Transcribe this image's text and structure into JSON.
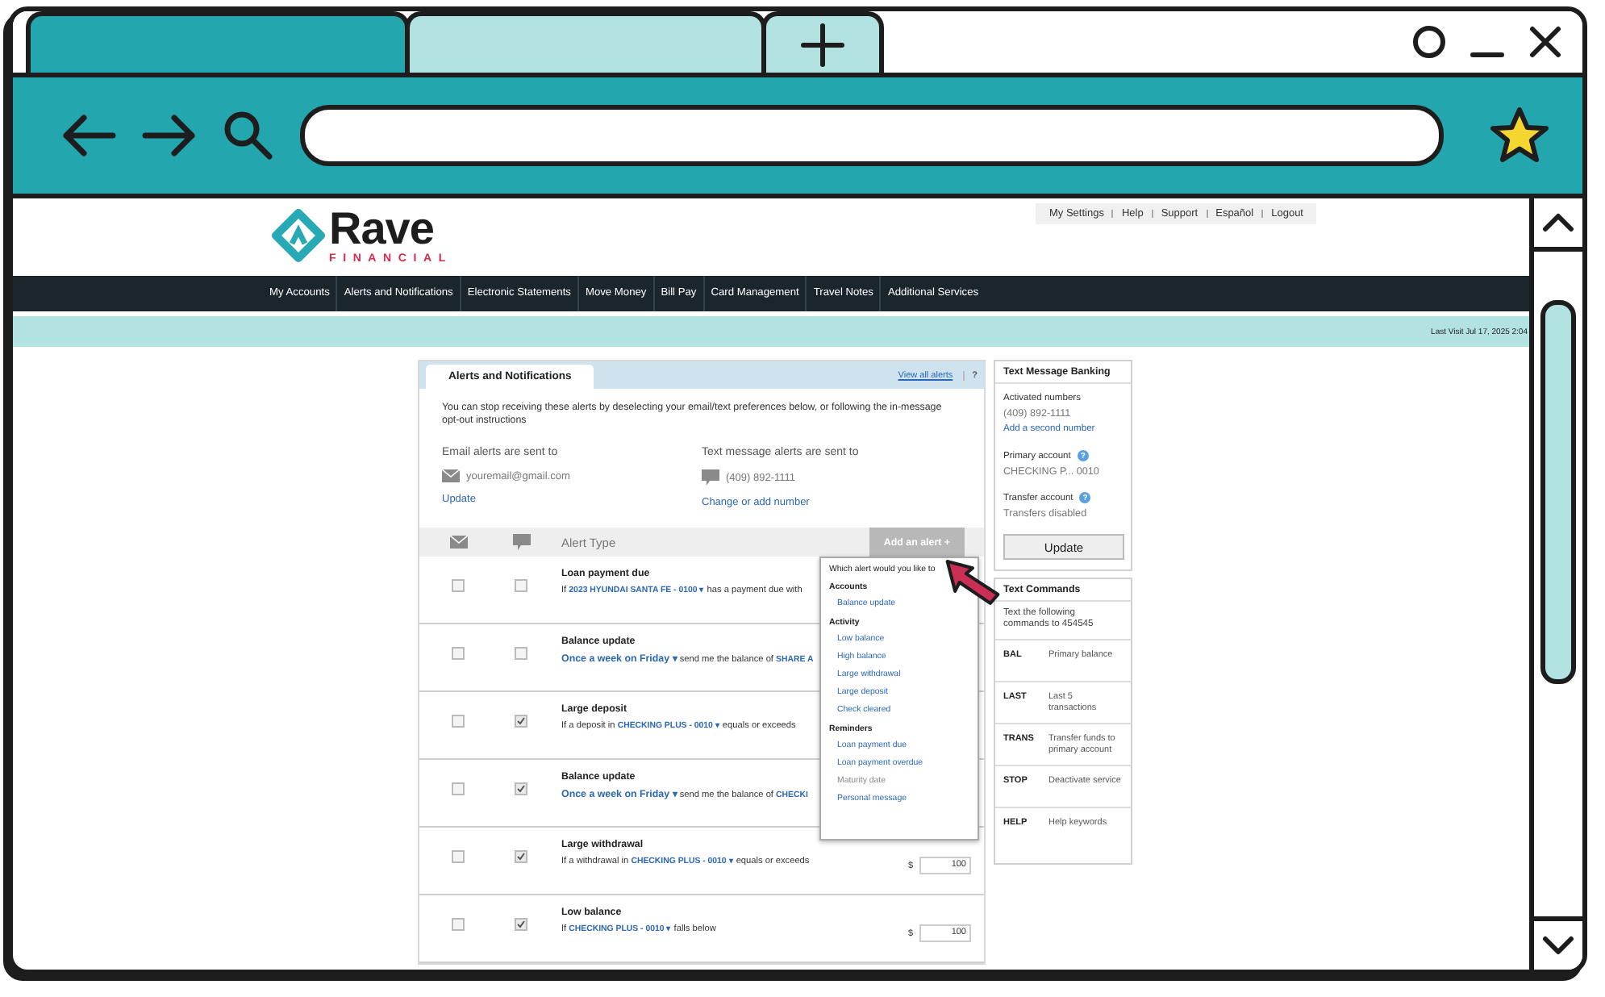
{
  "browser": {
    "tabs": [
      {
        "selected": true
      },
      {
        "selected": false
      }
    ]
  },
  "page": {
    "logo": {
      "name": "Rave",
      "tagline": "FINANCIAL"
    },
    "utility_links": [
      "My Settings",
      "Help",
      "Support",
      "Español",
      "Logout"
    ],
    "nav": [
      "My Accounts",
      "Alerts and Notifications",
      "Electronic Statements",
      "Move Money",
      "Bill Pay",
      "Card Management",
      "Travel Notes",
      "Additional Services"
    ],
    "last_visit": "Last Visit Jul 17, 2025 2:04",
    "alerts": {
      "tab": "Alerts and Notifications",
      "view_all": "View all alerts",
      "help": "?",
      "intro": "You can stop receiving these alerts by deselecting your email/text preferences below, or following the in-message opt-out instructions",
      "email_label": "Email alerts are sent to",
      "email": "youremail@gmail.com",
      "email_link": "Update",
      "text_label": "Text message alerts are sent to",
      "phone": "(409) 892-1111",
      "text_link": "Change or add number",
      "column_alert_type": "Alert Type",
      "add_button": "Add an alert +",
      "rows": [
        {
          "title": "Loan payment due",
          "email_checked": false,
          "text_checked": false,
          "description": [
            {
              "kind": "text",
              "text": "If "
            },
            {
              "kind": "account",
              "text": "2023 HYUNDAI SANTA FE - 0100 ▾"
            },
            {
              "kind": "text",
              "text": " has a payment due with"
            }
          ]
        },
        {
          "title": "Balance update",
          "email_checked": false,
          "text_checked": false,
          "description": [
            {
              "kind": "link",
              "text": "Once a week on Friday ▾"
            },
            {
              "kind": "text",
              "text": " send me the balance of "
            },
            {
              "kind": "account",
              "text": "SHARE A"
            }
          ]
        },
        {
          "title": "Large deposit",
          "email_checked": false,
          "text_checked": true,
          "description": [
            {
              "kind": "text",
              "text": "If a deposit in "
            },
            {
              "kind": "account",
              "text": "CHECKING PLUS - 0010 ▾"
            },
            {
              "kind": "text",
              "text": " equals or exceeds"
            }
          ]
        },
        {
          "title": "Balance update",
          "email_checked": false,
          "text_checked": true,
          "description": [
            {
              "kind": "link",
              "text": "Once a week on Friday ▾"
            },
            {
              "kind": "text",
              "text": " send me the balance of "
            },
            {
              "kind": "account",
              "text": "CHECKI"
            }
          ]
        },
        {
          "title": "Large withdrawal",
          "email_checked": false,
          "text_checked": true,
          "description": [
            {
              "kind": "text",
              "text": "If a withdrawal in "
            },
            {
              "kind": "account",
              "text": "CHECKING PLUS - 0010 ▾"
            },
            {
              "kind": "text",
              "text": " equals or exceeds"
            }
          ],
          "amount": {
            "currency": "$",
            "value": "100"
          }
        },
        {
          "title": "Low balance",
          "email_checked": false,
          "text_checked": true,
          "description": [
            {
              "kind": "text",
              "text": "If "
            },
            {
              "kind": "account",
              "text": "CHECKING PLUS - 0010 ▾"
            },
            {
              "kind": "text",
              "text": " falls below"
            }
          ],
          "amount": {
            "currency": "$",
            "value": "100"
          }
        }
      ],
      "dropdown": {
        "prompt": "Which alert would you like to",
        "groups": [
          {
            "heading": "Accounts",
            "items": [
              {
                "label": "Balance update",
                "disabled": false
              }
            ]
          },
          {
            "heading": "Activity",
            "items": [
              {
                "label": "Low balance",
                "disabled": false
              },
              {
                "label": "High balance",
                "disabled": false
              },
              {
                "label": "Large withdrawal",
                "disabled": false
              },
              {
                "label": "Large deposit",
                "disabled": false
              },
              {
                "label": "Check cleared",
                "disabled": false
              }
            ]
          },
          {
            "heading": "Reminders",
            "items": [
              {
                "label": "Loan payment due",
                "disabled": false
              },
              {
                "label": "Loan payment overdue",
                "disabled": false
              },
              {
                "label": "Maturity date",
                "disabled": true
              },
              {
                "label": "Personal message",
                "disabled": false
              }
            ]
          }
        ]
      }
    },
    "text_banking": {
      "title": "Text Message Banking",
      "activated_label": "Activated numbers",
      "number": "(409) 892-1111",
      "add_link": "Add a second number",
      "primary_label": "Primary account",
      "primary_help": "?",
      "primary_value": "CHECKING P... 0010",
      "transfer_label": "Transfer account",
      "transfer_help": "?",
      "transfer_value": "Transfers disabled",
      "button": "Update"
    },
    "text_commands": {
      "title": "Text Commands",
      "intro": "Text the following commands to 454545",
      "commands": [
        {
          "code": "BAL",
          "meaning": "Primary balance"
        },
        {
          "code": "LAST",
          "meaning": "Last 5 transactions"
        },
        {
          "code": "TRANS",
          "meaning": "Transfer funds to primary account"
        },
        {
          "code": "STOP",
          "meaning": "Deactivate service"
        },
        {
          "code": "HELP",
          "meaning": "Help keywords"
        }
      ]
    }
  }
}
